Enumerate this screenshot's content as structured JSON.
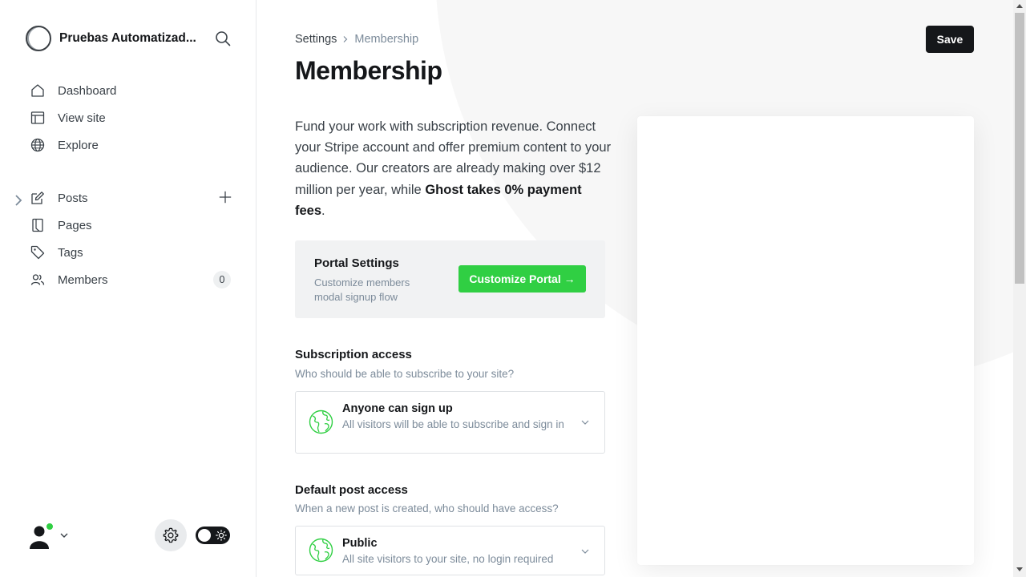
{
  "sidebar": {
    "site_name": "Pruebas Automatizad...",
    "nav_primary": [
      {
        "label": "Dashboard",
        "icon": "home-icon"
      },
      {
        "label": "View site",
        "icon": "layout-icon"
      },
      {
        "label": "Explore",
        "icon": "globe-icon"
      }
    ],
    "nav_secondary": [
      {
        "label": "Posts",
        "icon": "pen-icon"
      },
      {
        "label": "Pages",
        "icon": "page-icon"
      },
      {
        "label": "Tags",
        "icon": "tag-icon"
      },
      {
        "label": "Members",
        "icon": "members-icon",
        "count": "0"
      }
    ]
  },
  "header": {
    "breadcrumb_parent": "Settings",
    "breadcrumb_current": "Membership",
    "title": "Membership",
    "save_label": "Save"
  },
  "intro": {
    "text_before": "Fund your work with subscription revenue. Connect your Stripe account and offer premium content to your audience. Our creators are already making over $12 million per year, while ",
    "text_bold": "Ghost takes 0% payment fees",
    "text_after": "."
  },
  "portal": {
    "title": "Portal Settings",
    "description": "Customize members modal signup flow",
    "button_label": "Customize Portal →"
  },
  "subscription_access": {
    "title": "Subscription access",
    "description": "Who should be able to subscribe to your site?",
    "selected_title": "Anyone can sign up",
    "selected_description": "All visitors will be able to subscribe and sign in"
  },
  "default_post_access": {
    "title": "Default post access",
    "description": "When a new post is created, who should have access?",
    "selected_title": "Public",
    "selected_description": "All site visitors to your site, no login required"
  },
  "colors": {
    "accent_green": "#30cf43",
    "dark": "#15171a",
    "muted": "#7c8b9a"
  }
}
